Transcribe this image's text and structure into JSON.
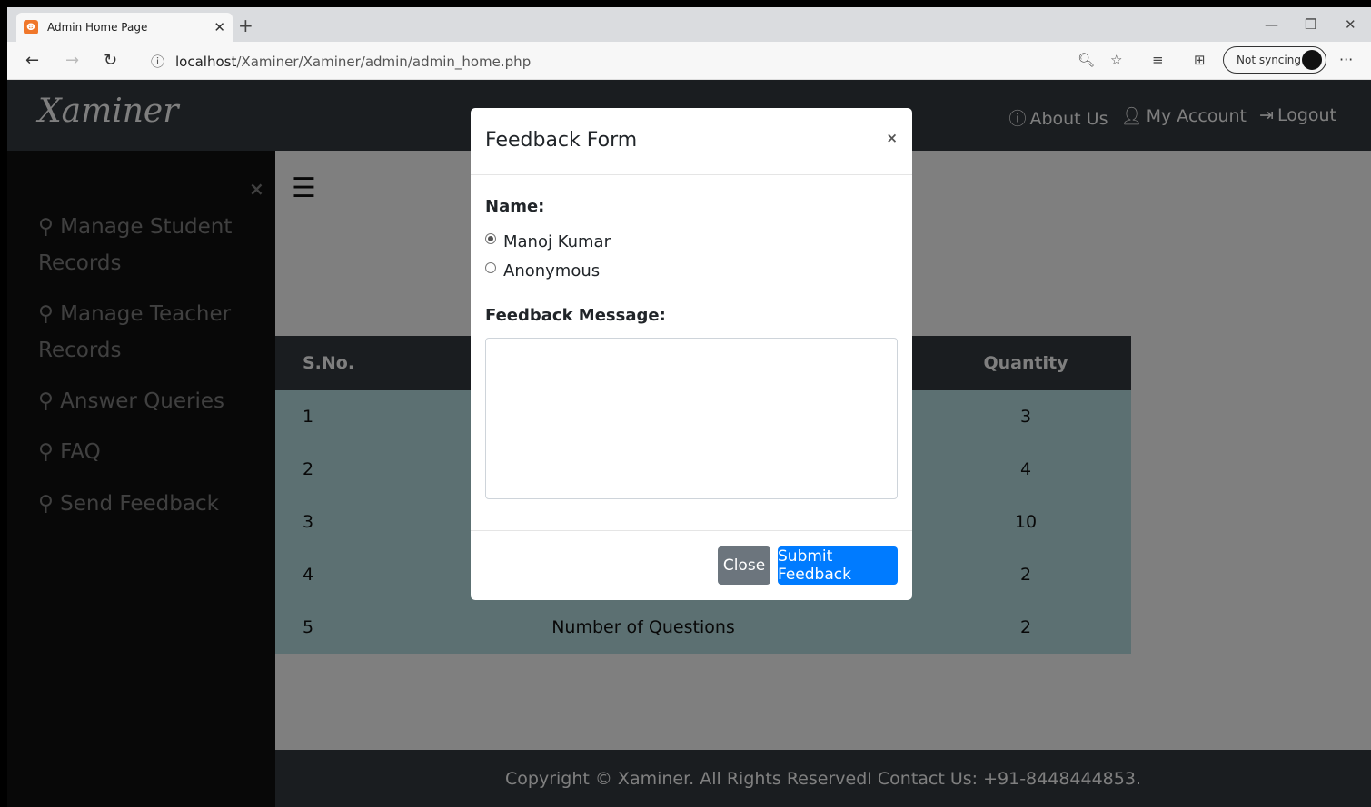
{
  "browser": {
    "tab_title": "Admin Home Page",
    "tab_favicon": "XAMPP",
    "url_host": "localhost",
    "url_path": "/Xaminer/Xaminer/admin/admin_home.php",
    "sync_label": "Not syncing"
  },
  "navbar": {
    "brand": "Xaminer",
    "links": [
      "About Us",
      "My Account",
      "Logout"
    ]
  },
  "sidebar": {
    "close": "×",
    "items": [
      "Manage Student Records",
      "Manage Teacher Records",
      "Answer Queries",
      "FAQ",
      "Send Feedback"
    ]
  },
  "table": {
    "headers": [
      "S.No.",
      "",
      "Quantity"
    ],
    "rows": [
      {
        "sno": "1",
        "name": "",
        "qty": "3"
      },
      {
        "sno": "2",
        "name": "",
        "qty": "4"
      },
      {
        "sno": "3",
        "name": "",
        "qty": "10"
      },
      {
        "sno": "4",
        "name": "",
        "qty": "2"
      },
      {
        "sno": "5",
        "name": "Number of Questions",
        "qty": "2"
      }
    ]
  },
  "footer": {
    "text": "Copyright © Xaminer. All Rights ReservedI Contact Us: +91-8448444853."
  },
  "modal": {
    "title": "Feedback Form",
    "close": "×",
    "name_label": "Name:",
    "options": [
      "Manoj Kumar",
      "Anonymous"
    ],
    "selected": "Manoj Kumar",
    "message_label": "Feedback Message:",
    "message_value": "",
    "close_button": "Close",
    "submit_button": "Submit Feedback"
  },
  "colors": {
    "navbar": "#343a40",
    "sidebar": "#111111",
    "primary": "#007bff",
    "secondary": "#6c757d",
    "row": "#b8e0e4"
  }
}
